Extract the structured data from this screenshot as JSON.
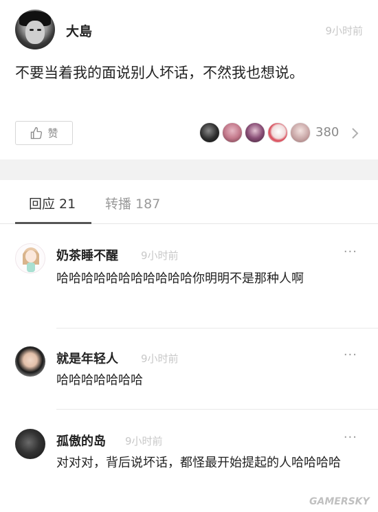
{
  "post": {
    "author": "大島",
    "time": "9小时前",
    "text": "不要当着我的面说别人坏话，不然我也想说。",
    "like_label": "赞",
    "like_count": "380",
    "liker_colors": [
      "#2b2b2b",
      "#c47a8c",
      "#6a3b5e",
      "#e9d8d8",
      "#c9a7a7"
    ]
  },
  "tabs": {
    "replies": "回应 21",
    "reposts": "转播 187"
  },
  "comments": [
    {
      "name": "奶茶睡不醒",
      "time": "9小时前",
      "text": "哈哈哈哈哈哈哈哈哈哈哈你明明不是那种人啊",
      "more": "···"
    },
    {
      "name": "就是年轻人",
      "time": "9小时前",
      "text": "哈哈哈哈哈哈哈",
      "more": "···"
    },
    {
      "name": "孤傲的岛",
      "time": "9小时前",
      "text": "对对对，背后说坏话，都怪最开始提起的人哈哈哈哈",
      "more": "···"
    }
  ],
  "watermark": "GAMERSKY"
}
